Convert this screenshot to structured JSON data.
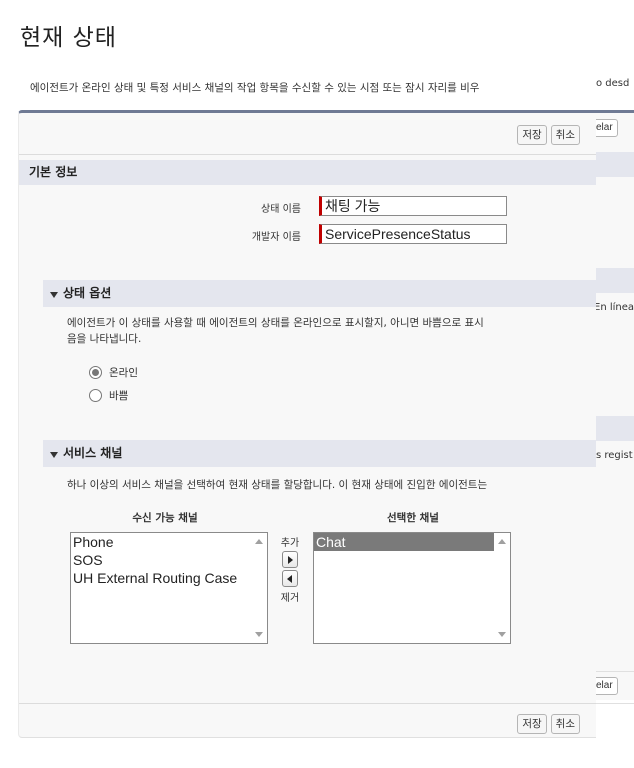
{
  "page": {
    "title": "현재 상태",
    "description": "에이전트가 온라인 상태 및 특정 서비스 채널의 작업 항목을 수신할 수 있는 시점 또는 잠시 자리를 비우"
  },
  "background_page": {
    "desc_fragment": "o desd",
    "cancel_fragment": "celar",
    "online_fragment": "En línea",
    "channels_fragment": "s regist"
  },
  "toolbar": {
    "save_label": "저장",
    "cancel_label": "취소"
  },
  "basic_info": {
    "header": "기본 정보",
    "status_name_label": "상태 이름",
    "status_name_value": "채팅 가능",
    "developer_name_label": "개발자 이름",
    "developer_name_value": "ServicePresenceStatus"
  },
  "status_options": {
    "header": "상태 옵션",
    "help_line1": "에이전트가 이 상태를 사용할 때 에이전트의 상태를 온라인으로 표시할지, 아니면 바쁨으로 표시",
    "help_line2": "음을 나타냅니다.",
    "options": [
      {
        "label": "온라인",
        "checked": true
      },
      {
        "label": "바쁨",
        "checked": false
      }
    ]
  },
  "service_channels": {
    "header": "서비스 채널",
    "help_text": "하나 이상의 서비스 채널을 선택하여 현재 상태를 할당합니다. 이 현재 상태에 진입한 에이전트는",
    "available_label": "수신 가능 채널",
    "selected_label": "선택한 채널",
    "add_label": "추가",
    "remove_label": "제거",
    "available": [
      "Phone",
      "SOS",
      "UH External Routing Case"
    ],
    "selected": [
      {
        "label": "Chat",
        "highlighted": true
      }
    ]
  },
  "colors": {
    "panel_top_border": "#6f7a94",
    "section_bg": "#e4e6ee",
    "required_marker": "#c00000",
    "selected_option_bg": "#7a7a7a"
  }
}
